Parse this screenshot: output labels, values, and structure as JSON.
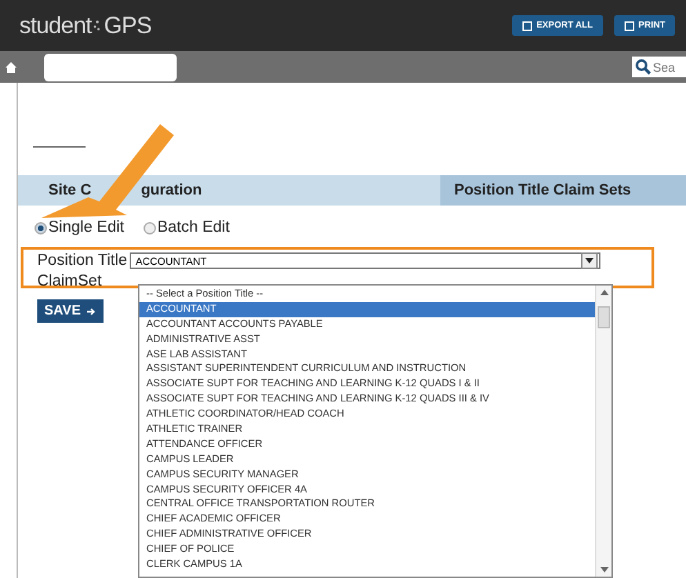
{
  "header": {
    "logo": "student GPS",
    "buttons": [
      "EXPORT ALL",
      "PRINT"
    ]
  },
  "breadcrumb": {
    "search": {
      "placeholder": "Sea"
    }
  },
  "tabs": [
    {
      "label_parts": [
        "Site C",
        "guration"
      ],
      "selected": false
    },
    {
      "label_parts": [
        "Position Title Claim Sets"
      ],
      "selected": true
    }
  ],
  "edit_mode": [
    {
      "label": "Single Edit",
      "selected": true
    },
    {
      "label": "Batch Edit",
      "selected": false
    }
  ],
  "form": {
    "position_title_label": "Position Title",
    "position_title_value": "ACCOUNTANT",
    "claimset_label": "ClaimSet",
    "save_button": "SAVE"
  },
  "dropdown": {
    "expanded": true,
    "items": [
      {
        "label": "-- Select a Position Title --",
        "selected": false
      },
      {
        "label": "ACCOUNTANT",
        "selected": true
      },
      {
        "label": "ACCOUNTANT ACCOUNTS PAYABLE",
        "selected": false
      },
      {
        "label": "ADMINISTRATIVE ASST",
        "selected": false
      },
      {
        "label": "ASE LAB ASSISTANT",
        "selected": false
      },
      {
        "label": "ASSISTANT SUPERINTENDENT CURRICULUM AND INSTRUCTION",
        "selected": false
      },
      {
        "label": "ASSOCIATE SUPT FOR TEACHING AND LEARNING K-12 QUADS I & II",
        "selected": false
      },
      {
        "label": "ASSOCIATE SUPT FOR TEACHING AND LEARNING K-12 QUADS III & IV",
        "selected": false
      },
      {
        "label": "ATHLETIC COORDINATOR/HEAD COACH",
        "selected": false
      },
      {
        "label": "ATHLETIC TRAINER",
        "selected": false
      },
      {
        "label": "ATTENDANCE OFFICER",
        "selected": false
      },
      {
        "label": "CAMPUS LEADER",
        "selected": false
      },
      {
        "label": "CAMPUS SECURITY MANAGER",
        "selected": false
      },
      {
        "label": "CAMPUS SECURITY OFFICER 4A",
        "selected": false
      },
      {
        "label": "CENTRAL OFFICE TRANSPORTATION ROUTER",
        "selected": false
      },
      {
        "label": "CHIEF ACADEMIC OFFICER",
        "selected": false
      },
      {
        "label": "CHIEF ADMINISTRATIVE OFFICER",
        "selected": false
      },
      {
        "label": "CHIEF OF POLICE",
        "selected": false
      },
      {
        "label": "CLERK CAMPUS 1A",
        "selected": false
      }
    ]
  }
}
